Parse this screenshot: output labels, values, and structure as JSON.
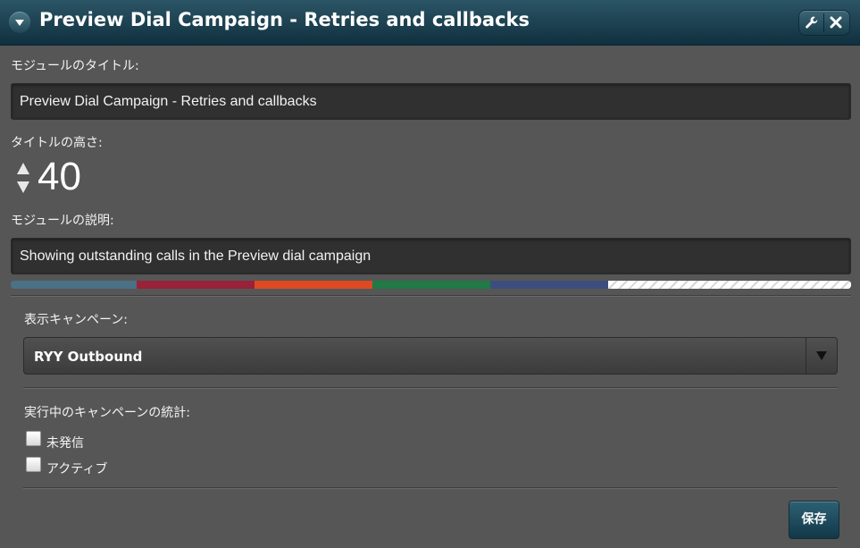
{
  "header": {
    "title": "Preview Dial Campaign - Retries and callbacks",
    "collapse_icon": "chevron-down-icon",
    "settings_icon": "wrench-icon",
    "close_icon": "close-icon"
  },
  "module_title": {
    "label": "モジュールのタイトル:",
    "value": "Preview Dial Campaign - Retries and callbacks"
  },
  "title_height": {
    "label": "タイトルの高さ:",
    "value": "40"
  },
  "module_description": {
    "label": "モジュールの説明:",
    "value": "Showing outstanding calls in the Preview dial campaign"
  },
  "color_swatches": [
    "#4a7186",
    "#99213a",
    "#dd4a22",
    "#1f7a46",
    "#3d4e7e",
    "#ffffff"
  ],
  "campaign": {
    "label": "表示キャンペーン:",
    "selected": "RYY Outbound"
  },
  "stats": {
    "label": "実行中のキャンペーンの統計:",
    "options": [
      {
        "label": "未発信",
        "checked": false
      },
      {
        "label": "アクティブ",
        "checked": false
      }
    ]
  },
  "footer": {
    "save_label": "保存"
  }
}
